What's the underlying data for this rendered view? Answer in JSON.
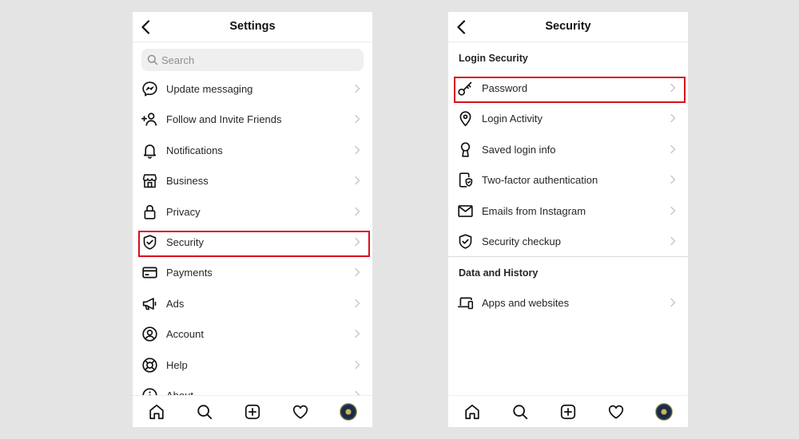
{
  "settings_screen": {
    "title": "Settings",
    "search_placeholder": "Search",
    "items": [
      {
        "label": "Update messaging",
        "icon": "messenger-icon"
      },
      {
        "label": "Follow and Invite Friends",
        "icon": "add-person-icon"
      },
      {
        "label": "Notifications",
        "icon": "bell-icon"
      },
      {
        "label": "Business",
        "icon": "shop-icon"
      },
      {
        "label": "Privacy",
        "icon": "lock-icon"
      },
      {
        "label": "Security",
        "icon": "shield-check-icon",
        "highlighted": true
      },
      {
        "label": "Payments",
        "icon": "credit-card-icon"
      },
      {
        "label": "Ads",
        "icon": "megaphone-icon"
      },
      {
        "label": "Account",
        "icon": "account-circle-icon"
      },
      {
        "label": "Help",
        "icon": "lifebuoy-icon"
      },
      {
        "label": "About",
        "icon": "info-icon"
      }
    ]
  },
  "security_screen": {
    "title": "Security",
    "sections": [
      {
        "title": "Login Security",
        "items": [
          {
            "label": "Password",
            "icon": "key-icon",
            "highlighted": true
          },
          {
            "label": "Login Activity",
            "icon": "location-pin-icon"
          },
          {
            "label": "Saved login info",
            "icon": "keyhole-icon"
          },
          {
            "label": "Two-factor authentication",
            "icon": "phone-shield-icon"
          },
          {
            "label": "Emails from Instagram",
            "icon": "envelope-icon"
          },
          {
            "label": "Security checkup",
            "icon": "shield-check-icon"
          }
        ]
      },
      {
        "title": "Data and History",
        "items": [
          {
            "label": "Apps and websites",
            "icon": "devices-icon"
          }
        ]
      }
    ]
  },
  "tab_bar": {
    "tabs": [
      "home-icon",
      "search-icon",
      "new-post-icon",
      "heart-icon",
      "profile-avatar"
    ]
  },
  "colors": {
    "highlight": "#d8101d",
    "background": "#e4e4e4",
    "text": "#262626",
    "chevron": "#c7c7c7"
  }
}
